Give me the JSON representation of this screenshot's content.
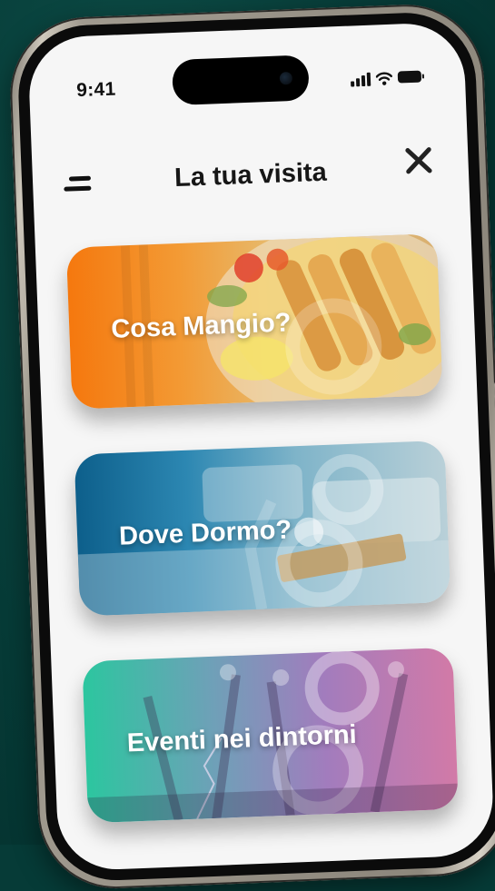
{
  "status_bar": {
    "time": "9:41"
  },
  "header": {
    "title": "La tua visita"
  },
  "cards": [
    {
      "label": "Cosa Mangio?"
    },
    {
      "label": "Dove Dormo?"
    },
    {
      "label": "Eventi nei dintorni"
    }
  ],
  "colors": {
    "background": "#063b37",
    "screen": "#f6f6f6",
    "food_card_accent": "#f5780e",
    "sleep_card_accent": "#0d5f8b",
    "events_card_accent": "#2cc69f"
  },
  "icons": {
    "menu": "menu-icon",
    "close": "close-icon",
    "signal": "signal-icon",
    "wifi": "wifi-icon",
    "battery": "battery-icon"
  }
}
